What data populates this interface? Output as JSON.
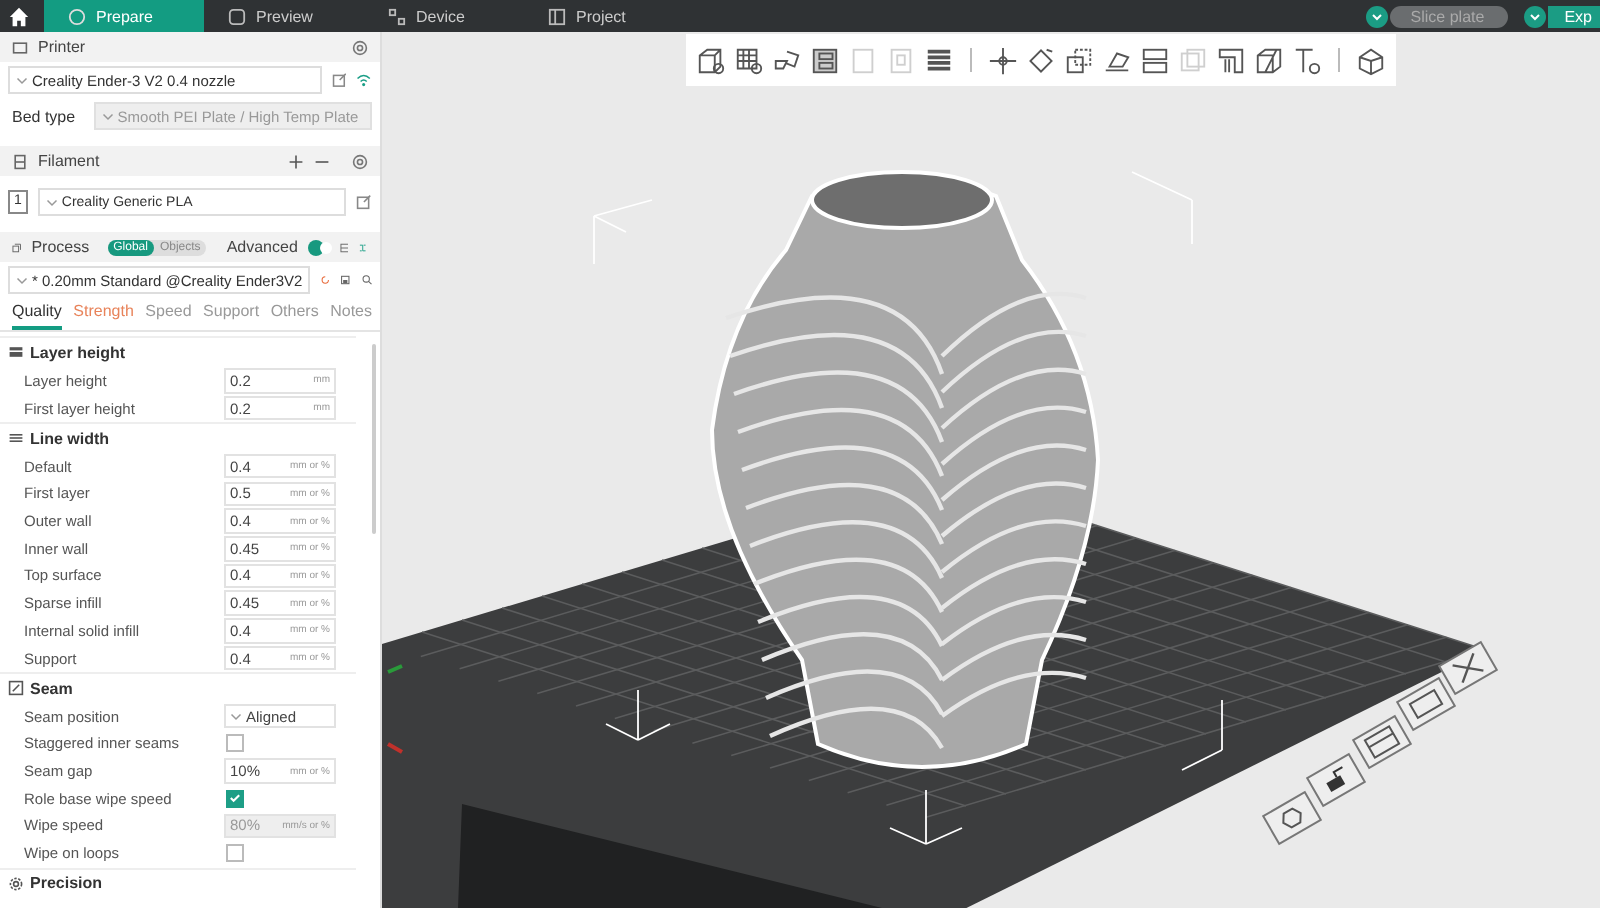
{
  "top_tabs": [
    {
      "label": "Prepare",
      "kind": "prepare",
      "selected": true
    },
    {
      "label": "Preview",
      "kind": "preview",
      "selected": false
    },
    {
      "label": "Device",
      "kind": "device",
      "selected": false
    },
    {
      "label": "Project",
      "kind": "project",
      "selected": false
    }
  ],
  "slice_button": {
    "label": "Slice plate",
    "disabled": true
  },
  "export_button": {
    "label": "Exp",
    "disabled": false
  },
  "printer": {
    "title": "Printer",
    "preset": "Creality Ender-3 V2 0.4 nozzle",
    "bed_type_label": "Bed type",
    "bed_type": "Smooth PEI Plate / High Temp Plate"
  },
  "filament": {
    "title": "Filament",
    "items": [
      {
        "index": "1",
        "name": "Creality Generic PLA"
      }
    ]
  },
  "process": {
    "title": "Process",
    "scopes": [
      {
        "label": "Global",
        "selected": true
      },
      {
        "label": "Objects",
        "selected": false
      }
    ],
    "advanced_label": "Advanced",
    "advanced_on": true,
    "preset": "* 0.20mm Standard @Creality Ender3V2"
  },
  "setting_tabs": [
    {
      "label": "Quality",
      "selected": true,
      "modified": false
    },
    {
      "label": "Strength",
      "selected": false,
      "modified": true
    },
    {
      "label": "Speed",
      "selected": false,
      "modified": false
    },
    {
      "label": "Support",
      "selected": false,
      "modified": false
    },
    {
      "label": "Others",
      "selected": false,
      "modified": false
    },
    {
      "label": "Notes",
      "selected": false,
      "modified": false
    }
  ],
  "groups": [
    {
      "title": "Layer height",
      "kind": "layers",
      "settings": [
        {
          "label": "Layer height",
          "kind": "number",
          "value": "0.2",
          "unit": "mm",
          "disabled": false
        },
        {
          "label": "First layer height",
          "kind": "number",
          "value": "0.2",
          "unit": "mm",
          "disabled": false
        }
      ]
    },
    {
      "title": "Line width",
      "kind": "lines",
      "settings": [
        {
          "label": "Default",
          "kind": "number",
          "value": "0.4",
          "unit": "mm or %",
          "disabled": false
        },
        {
          "label": "First layer",
          "kind": "number",
          "value": "0.5",
          "unit": "mm or %",
          "disabled": false
        },
        {
          "label": "Outer wall",
          "kind": "number",
          "value": "0.4",
          "unit": "mm or %",
          "disabled": false
        },
        {
          "label": "Inner wall",
          "kind": "number",
          "value": "0.45",
          "unit": "mm or %",
          "disabled": false
        },
        {
          "label": "Top surface",
          "kind": "number",
          "value": "0.4",
          "unit": "mm or %",
          "disabled": false
        },
        {
          "label": "Sparse infill",
          "kind": "number",
          "value": "0.45",
          "unit": "mm or %",
          "disabled": false
        },
        {
          "label": "Internal solid infill",
          "kind": "number",
          "value": "0.4",
          "unit": "mm or %",
          "disabled": false
        },
        {
          "label": "Support",
          "kind": "number",
          "value": "0.4",
          "unit": "mm or %",
          "disabled": false
        }
      ]
    },
    {
      "title": "Seam",
      "kind": "seam",
      "settings": [
        {
          "label": "Seam position",
          "kind": "dropdown",
          "value": "Aligned",
          "disabled": false
        },
        {
          "label": "Staggered inner seams",
          "kind": "checkbox",
          "checked": false
        },
        {
          "label": "Seam gap",
          "kind": "number",
          "value": "10%",
          "unit": "mm or %",
          "disabled": false
        },
        {
          "label": "Role base wipe speed",
          "kind": "checkbox",
          "checked": true
        },
        {
          "label": "Wipe speed",
          "kind": "number",
          "value": "80%",
          "unit": "mm/s or %",
          "disabled": true
        },
        {
          "label": "Wipe on loops",
          "kind": "checkbox",
          "checked": false
        }
      ]
    },
    {
      "title": "Precision",
      "kind": "gear"
    }
  ],
  "toolbar": [
    {
      "kind": "add-cube",
      "disabled": false
    },
    {
      "kind": "add-grid",
      "disabled": false
    },
    {
      "kind": "orient",
      "disabled": false
    },
    {
      "kind": "arrange",
      "disabled": false
    },
    {
      "kind": "box-d",
      "disabled": true
    },
    {
      "kind": "box-p",
      "disabled": true
    },
    {
      "kind": "layers",
      "disabled": false
    },
    {
      "kind": "separator"
    },
    {
      "kind": "move",
      "disabled": false
    },
    {
      "kind": "rotate",
      "disabled": false
    },
    {
      "kind": "scale",
      "disabled": false
    },
    {
      "kind": "flat",
      "disabled": false
    },
    {
      "kind": "split",
      "disabled": false
    },
    {
      "kind": "boxes",
      "disabled": true
    },
    {
      "kind": "paint",
      "disabled": false
    },
    {
      "kind": "cut",
      "disabled": false
    },
    {
      "kind": "text",
      "disabled": false
    },
    {
      "kind": "separator"
    },
    {
      "kind": "assembly",
      "disabled": false
    }
  ]
}
